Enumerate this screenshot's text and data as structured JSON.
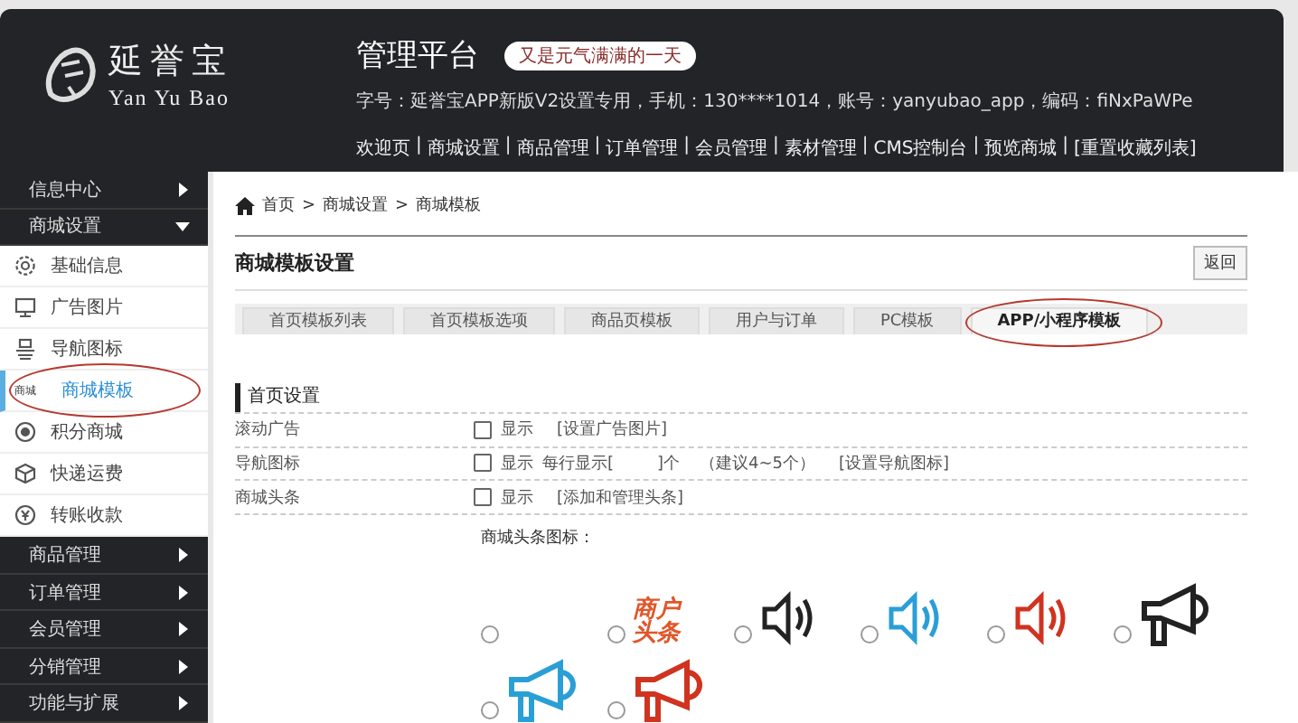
{
  "header": {
    "logo_chinese": "延誉宝",
    "logo_latin": "Yan Yu Bao",
    "title": "管理平台",
    "greeting": "又是元气满满的一天",
    "account_line": "字号：延誉宝APP新版V2设置专用，手机：130****1014，账号：yanyubao_app，编码：fiNxPaWPe",
    "nav": [
      "欢迎页",
      "商城设置",
      "商品管理",
      "订单管理",
      "会员管理",
      "素材管理",
      "CMS控制台",
      "预览商城",
      "[重置收藏列表]"
    ],
    "separator": "|"
  },
  "sidebar": [
    {
      "label": "信息中心",
      "expanded": false
    },
    {
      "label": "商城设置",
      "expanded": true,
      "children": [
        {
          "label": "基础信息",
          "selected": false,
          "circled": false
        },
        {
          "label": "广告图片",
          "selected": false,
          "circled": false
        },
        {
          "label": "导航图标",
          "selected": false,
          "circled": false
        },
        {
          "label": "商城模板",
          "icon_text": "商城",
          "selected": true,
          "circled": true
        },
        {
          "label": "积分商城",
          "selected": false,
          "circled": false
        },
        {
          "label": "快递运费",
          "selected": false,
          "circled": false
        },
        {
          "label": "转账收款",
          "selected": false,
          "circled": false
        }
      ]
    },
    {
      "label": "商品管理",
      "expanded": false
    },
    {
      "label": "订单管理",
      "expanded": false
    },
    {
      "label": "会员管理",
      "expanded": false
    },
    {
      "label": "分销管理",
      "expanded": false
    },
    {
      "label": "功能与扩展",
      "expanded": false
    }
  ],
  "breadcrumb": [
    "首页",
    "商城设置",
    "商城模板"
  ],
  "breadcrumb_separator": ">",
  "page_title": "商城模板设置",
  "back_button": "返回",
  "tabs": [
    {
      "label": "首页模板列表",
      "selected": false,
      "circled": false
    },
    {
      "label": "首页模板选项",
      "selected": false,
      "circled": false
    },
    {
      "label": "商品页模板",
      "selected": false,
      "circled": false
    },
    {
      "label": "用户与订单",
      "selected": false,
      "circled": false
    },
    {
      "label": "PC模板",
      "selected": false,
      "circled": false
    },
    {
      "label": "APP/小程序模板",
      "selected": true,
      "circled": true
    }
  ],
  "section_title": "首页设置",
  "settings": [
    {
      "label": "滚动广告",
      "checked": false,
      "option": "显示",
      "kind": "plain",
      "link": "[设置广告图片]"
    },
    {
      "label": "导航图标",
      "checked": false,
      "option": "显示",
      "kind": "per-row",
      "per_row_before": "每行显示[",
      "per_row_after": "]个",
      "hint": "（建议4~5个）",
      "link": "[设置导航图标]"
    },
    {
      "label": "商城头条",
      "checked": false,
      "option": "显示",
      "kind": "plain",
      "link": "[添加和管理头条]"
    }
  ],
  "headline_icon_label": "商城头条图标：",
  "headline_icons": [
    {
      "kind": "none",
      "selected": false
    },
    {
      "kind": "text",
      "text": "商户头条",
      "selected": false
    },
    {
      "kind": "speaker",
      "color": "#222222",
      "selected": false
    },
    {
      "kind": "speaker",
      "color": "#2a9fd6",
      "selected": false
    },
    {
      "kind": "speaker",
      "color": "#d0331f",
      "selected": false
    },
    {
      "kind": "megaphone",
      "color": "#222222",
      "selected": false
    },
    {
      "kind": "megaphone",
      "color": "#2a9fd6",
      "selected": false
    },
    {
      "kind": "megaphone",
      "color": "#d0331f",
      "selected": false
    }
  ]
}
